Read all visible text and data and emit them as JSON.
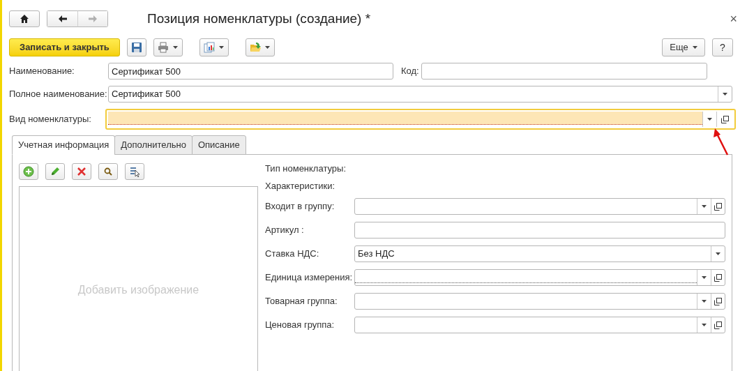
{
  "window": {
    "title": "Позиция номенклатуры (создание) *",
    "close": "×"
  },
  "nav_buttons": [
    {
      "kind": "home",
      "disabled": false
    },
    {
      "kind": "back",
      "disabled": false
    },
    {
      "kind": "forward",
      "disabled": true
    }
  ],
  "toolbar": {
    "primary": "Записать и закрыть",
    "icon_buttons": [
      {
        "kind": "save",
        "dropdown": false
      },
      {
        "kind": "print",
        "dropdown": true
      },
      {
        "kind": "report",
        "dropdown": true
      },
      {
        "kind": "folder",
        "dropdown": true
      }
    ],
    "more": "Еще",
    "help": "?"
  },
  "name": {
    "label": "Наименование:",
    "value": "Сертификат 500"
  },
  "code": {
    "label": "Код:"
  },
  "full_name": {
    "label": "Полное наименование:",
    "value": "Сертификат 500",
    "kind": "select",
    "required": false,
    "focused": false
  },
  "item_kind": {
    "label": "Вид номенклатуры:",
    "kind": "lookup",
    "required": true,
    "focused": true
  },
  "tabs": [
    {
      "label": "Учетная информация",
      "selected": true
    },
    {
      "label": "Дополнительно",
      "selected": false
    },
    {
      "label": "Описание",
      "selected": false
    }
  ],
  "image_toolbar": [
    {
      "kind": "add"
    },
    {
      "kind": "edit"
    },
    {
      "kind": "delete"
    },
    {
      "kind": "search"
    },
    {
      "kind": "pick"
    }
  ],
  "image_placeholder": "Добавить изображение",
  "info_labels": [
    "Тип номенклатуры:",
    "Характеристики:"
  ],
  "details": [
    {
      "label": "Входит в группу:",
      "kind": "lookup",
      "required": false,
      "focused": false
    },
    {
      "label": "Артикул :",
      "kind": "text",
      "required": false,
      "focused": false
    },
    {
      "label": "Ставка НДС:",
      "value": "Без НДС",
      "kind": "select",
      "required": false,
      "focused": false
    },
    {
      "label": "Единица измерения:",
      "kind": "lookup",
      "required": true,
      "focused": false
    },
    {
      "label": "Товарная группа:",
      "kind": "lookup",
      "required": false,
      "focused": false
    },
    {
      "label": "Ценовая группа:",
      "kind": "lookup",
      "required": false,
      "focused": false
    }
  ]
}
